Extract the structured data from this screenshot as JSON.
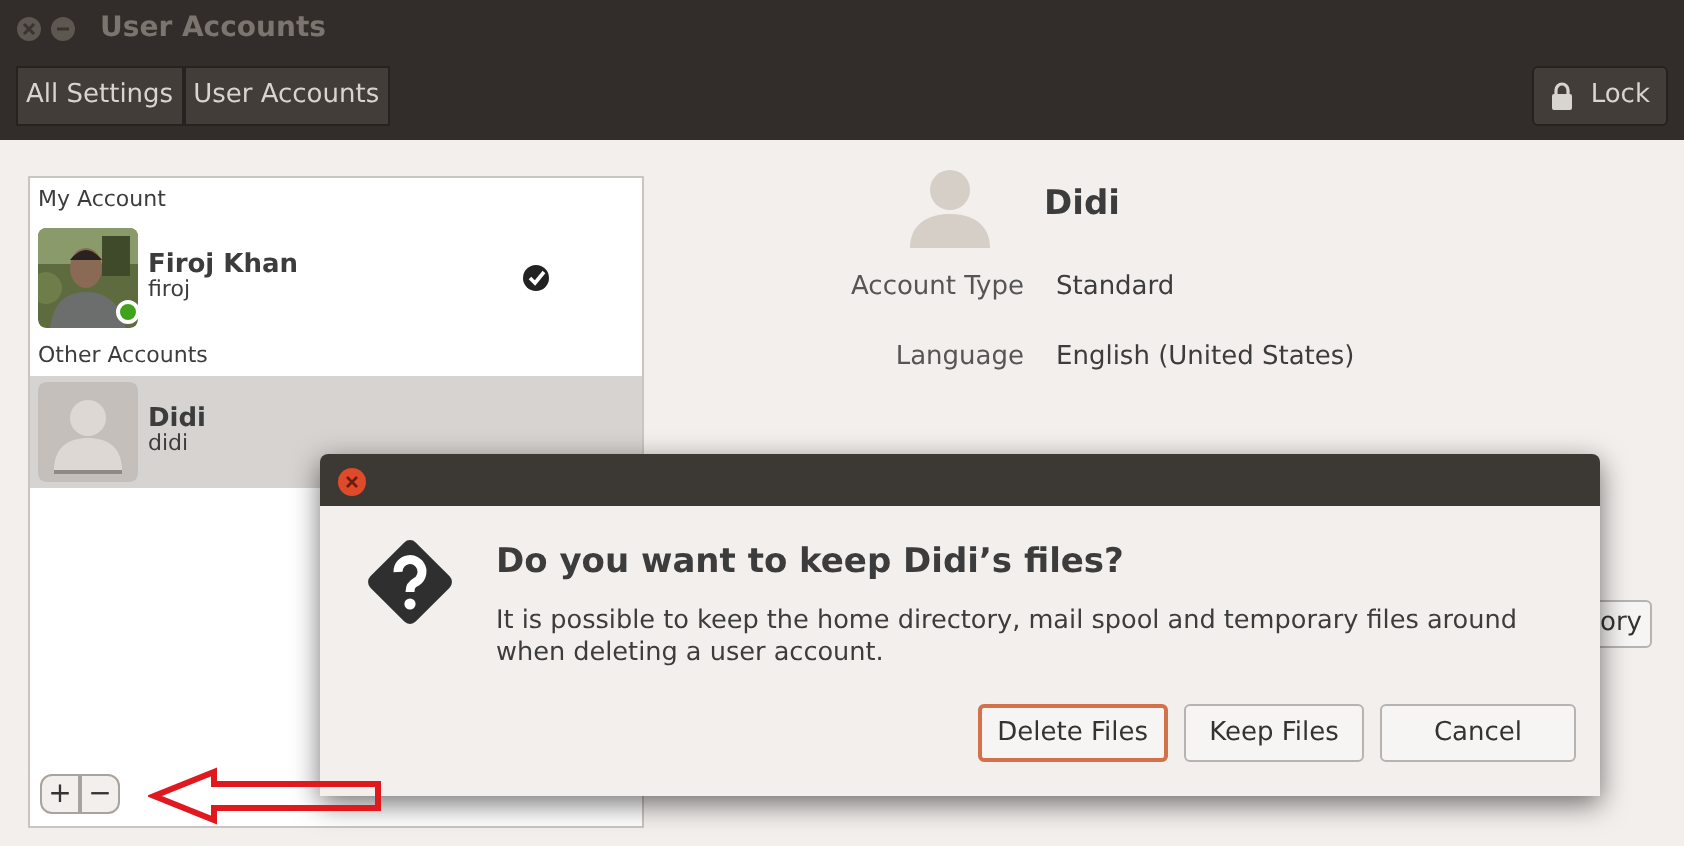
{
  "window": {
    "title": "User Accounts"
  },
  "breadcrumbs": [
    {
      "label": "All Settings"
    },
    {
      "label": "User Accounts"
    }
  ],
  "lock_button": {
    "label": "Lock"
  },
  "sidebar": {
    "sections": [
      {
        "heading": "My Account",
        "accounts": [
          {
            "name": "Firoj Khan",
            "username": "firoj",
            "online": true,
            "current": true,
            "selected": false
          }
        ]
      },
      {
        "heading": "Other Accounts",
        "accounts": [
          {
            "name": "Didi",
            "username": "didi",
            "kind": "default",
            "online": false,
            "current": false,
            "selected": true
          }
        ]
      }
    ],
    "add_button": "+",
    "remove_button": "−"
  },
  "details": {
    "name": "Didi",
    "fields": [
      {
        "label": "Account Type",
        "value": "Standard"
      },
      {
        "label": "Language",
        "value": "English (United States)"
      }
    ],
    "hidden_button": "ory"
  },
  "dialog": {
    "heading": "Do you want to keep Didi’s files?",
    "message": "It is possible to keep the home directory, mail spool and temporary files around when deleting a user account.",
    "buttons": [
      {
        "label": "Delete Files",
        "focused": true
      },
      {
        "label": "Keep Files",
        "focused": false
      },
      {
        "label": "Cancel",
        "focused": false
      }
    ]
  }
}
